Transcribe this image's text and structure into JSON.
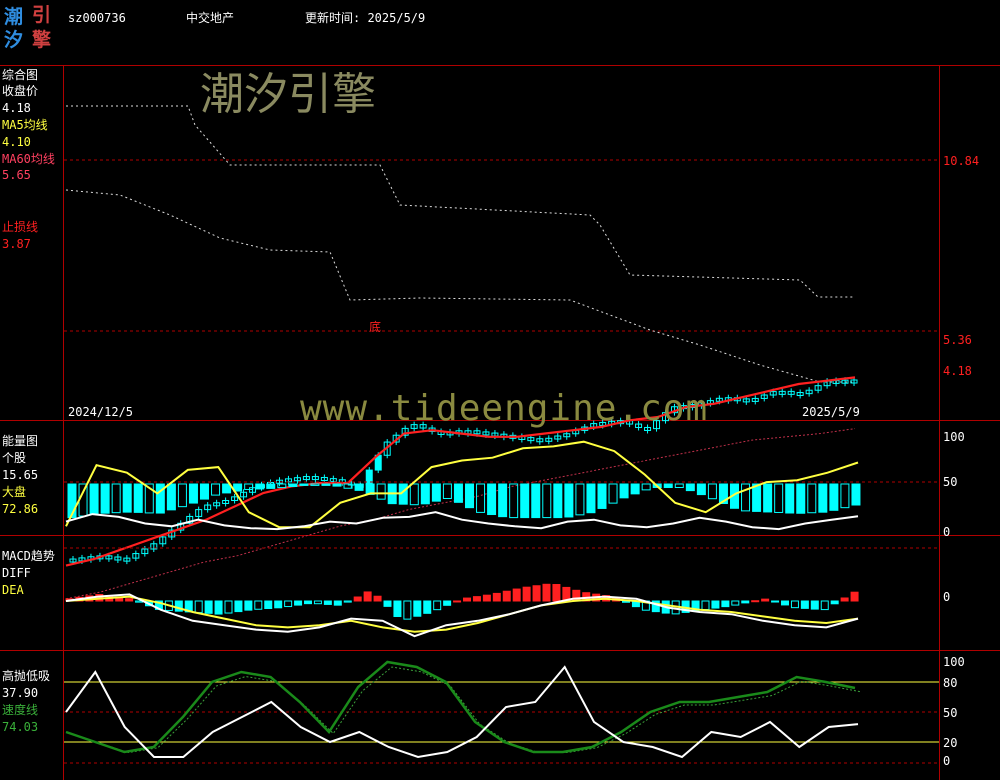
{
  "header": {
    "logo_chars": [
      "潮",
      "引",
      "汐",
      "擎"
    ],
    "code": "sz000736",
    "name": "中交地产",
    "update_label": "更新时间: 2025/5/9"
  },
  "watermarks": {
    "brand": "潮汐引擎",
    "site": "www.tideengine.com"
  },
  "colors": {
    "frame": "#b00000",
    "cyan": "#00ffff",
    "red": "#ff2020",
    "yellow": "#ffff40",
    "white": "#ffffff",
    "green": "#1a8a1a",
    "ma60": "#c0304a",
    "bg": "#000000"
  },
  "panel1": {
    "title": "综合图",
    "close_label": "收盘价",
    "close_value": "4.18",
    "ma5_label": "MA5均线",
    "ma5_value": "4.10",
    "ma60_label": "MA60均线",
    "ma60_value": "5.65",
    "stop_label": "止损线",
    "stop_value": "3.87",
    "right_ticks": [
      "10.84",
      "5.36",
      "4.18"
    ],
    "date_start": "2024/12/5",
    "date_end": "2025/5/9",
    "bottom_marker": "底"
  },
  "panel2": {
    "title": "能量图",
    "stock_label": "个股",
    "stock_value": "15.65",
    "market_label": "大盘",
    "market_value": "72.86",
    "right_ticks": [
      "100",
      "50",
      "0"
    ]
  },
  "panel3": {
    "title": "MACD趋势",
    "diff_label": "DIFF",
    "dea_label": "DEA",
    "right_ticks": [
      "0"
    ]
  },
  "panel4": {
    "title": "高抛低吸",
    "value": "37.90",
    "speed_label": "速度线",
    "speed_value": "74.03",
    "right_ticks": [
      "100",
      "80",
      "50",
      "20",
      "0"
    ]
  },
  "chart_data": [
    {
      "type": "candlestick",
      "title": "综合图",
      "x_range": [
        "2024/12/5",
        "2025/5/9"
      ],
      "y_ticks": [
        10.84,
        5.36,
        4.18
      ],
      "close_trend": [
        9.6,
        9.5,
        9.6,
        9.2,
        8.6,
        8.0,
        7.8,
        7.4,
        7.2,
        7.1,
        7.2,
        7.4,
        6.1,
        5.5,
        5.8,
        5.7,
        5.8,
        5.9,
        6.0,
        5.8,
        5.5,
        5.4,
        5.7,
        5.0,
        4.9,
        4.7,
        4.8,
        4.5,
        4.6,
        4.2,
        4.18
      ],
      "ma5": [
        9.8,
        9.6,
        9.3,
        9.0,
        8.7,
        8.4,
        8.0,
        7.6,
        7.4,
        7.3,
        7.3,
        6.5,
        5.8,
        5.7,
        5.8,
        5.9,
        5.9,
        5.8,
        5.7,
        5.6,
        5.4,
        5.3,
        5.0,
        4.9,
        4.7,
        4.5,
        4.3,
        4.2,
        4.1
      ],
      "ma60": [
        10.8,
        10.6,
        10.3,
        10.0,
        9.7,
        9.5,
        9.2,
        8.9,
        8.6,
        8.4,
        8.1,
        7.9,
        7.7,
        7.4,
        7.2,
        7.0,
        6.8,
        6.6,
        6.4,
        6.2,
        6.0,
        5.9,
        5.8,
        5.65
      ]
    },
    {
      "type": "bar+line",
      "title": "能量图",
      "y_range": [
        0,
        100
      ],
      "stock": [
        10,
        18,
        15,
        8,
        5,
        12,
        6,
        3,
        2,
        5,
        10,
        8,
        14,
        15,
        20,
        12,
        8,
        5,
        3,
        10,
        12,
        6,
        4,
        8,
        14,
        10,
        4,
        2,
        8,
        12,
        15.65
      ],
      "market": [
        5,
        70,
        62,
        40,
        65,
        68,
        20,
        4,
        4,
        30,
        40,
        40,
        68,
        75,
        78,
        88,
        90,
        95,
        85,
        60,
        30,
        20,
        40,
        52,
        54,
        62,
        72.86
      ],
      "bars": [
        48,
        42,
        40,
        42,
        30,
        15,
        8,
        6,
        2,
        2,
        10,
        28,
        30,
        20,
        40,
        48,
        48,
        48,
        40,
        20,
        5,
        5,
        20,
        38,
        40,
        42,
        40,
        30
      ]
    },
    {
      "type": "macd",
      "title": "MACD趋势",
      "diff": [
        0,
        0.2,
        0.3,
        -0.4,
        -0.9,
        -1.1,
        -1.3,
        -1.4,
        -1.2,
        -0.8,
        -0.9,
        -1.6,
        -1.1,
        -0.9,
        -0.6,
        -0.2,
        0.1,
        0.2,
        0.1,
        -0.3,
        -0.5,
        -0.6,
        -0.9,
        -1.1,
        -1.2,
        -0.8
      ],
      "dea": [
        0,
        0.1,
        0.2,
        -0.1,
        -0.5,
        -0.8,
        -1.1,
        -1.2,
        -1.1,
        -0.9,
        -1.2,
        -1.4,
        -1.3,
        -1.0,
        -0.6,
        -0.2,
        0.0,
        0.1,
        0.0,
        -0.2,
        -0.4,
        -0.5,
        -0.7,
        -0.9,
        -1.0,
        -0.8
      ],
      "histogram": [
        0.1,
        0.3,
        0.1,
        -0.4,
        -0.5,
        -0.6,
        -0.4,
        -0.3,
        -0.1,
        -0.2,
        0.5,
        -0.9,
        -0.5,
        0.1,
        0.3,
        0.6,
        0.8,
        0.4,
        0.2,
        -0.4,
        -0.6,
        -0.4,
        -0.2,
        0.1,
        -0.3,
        -0.4,
        0.4
      ]
    },
    {
      "type": "line",
      "title": "高抛低吸",
      "y_ticks": [
        100,
        80,
        50,
        20,
        0
      ],
      "value": [
        50,
        90,
        35,
        5,
        5,
        30,
        45,
        60,
        35,
        20,
        30,
        15,
        5,
        10,
        25,
        55,
        60,
        95,
        40,
        20,
        15,
        5,
        30,
        25,
        40,
        15,
        35,
        37.9
      ],
      "speed": [
        30,
        20,
        10,
        15,
        45,
        80,
        90,
        85,
        60,
        30,
        75,
        100,
        95,
        80,
        40,
        20,
        10,
        10,
        15,
        30,
        50,
        60,
        60,
        65,
        70,
        85,
        80,
        74.03
      ]
    }
  ]
}
